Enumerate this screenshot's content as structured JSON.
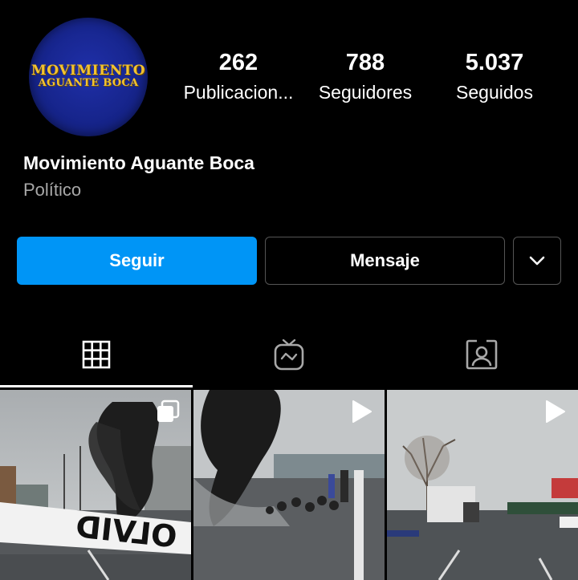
{
  "profile": {
    "avatar_text_line1": "MOVIMIENTO",
    "avatar_text_line2": "AGUANTE BOCA",
    "name": "Movimiento Aguante Boca",
    "category": "Político"
  },
  "stats": {
    "posts_count": "262",
    "posts_label": "Publicacion...",
    "followers_count": "788",
    "followers_label": "Seguidores",
    "following_count": "5.037",
    "following_label": "Seguidos"
  },
  "actions": {
    "follow_label": "Seguir",
    "message_label": "Mensaje",
    "more_icon": "chevron-down-icon"
  },
  "tabs": [
    {
      "name": "posts-grid",
      "icon": "grid-icon",
      "active": true
    },
    {
      "name": "igtv",
      "icon": "tv-icon",
      "active": false
    },
    {
      "name": "tagged",
      "icon": "tagged-person-icon",
      "active": false
    }
  ],
  "posts": [
    {
      "type": "carousel",
      "icon": "carousel-icon",
      "banner_text": "OLVID"
    },
    {
      "type": "video",
      "icon": "play-icon"
    },
    {
      "type": "video",
      "icon": "play-icon"
    }
  ],
  "colors": {
    "background": "#000000",
    "accent": "#0095f6",
    "secondary_text": "#a8a8a8",
    "avatar_blue": "#1f2fa8",
    "avatar_gold": "#f2c230"
  }
}
